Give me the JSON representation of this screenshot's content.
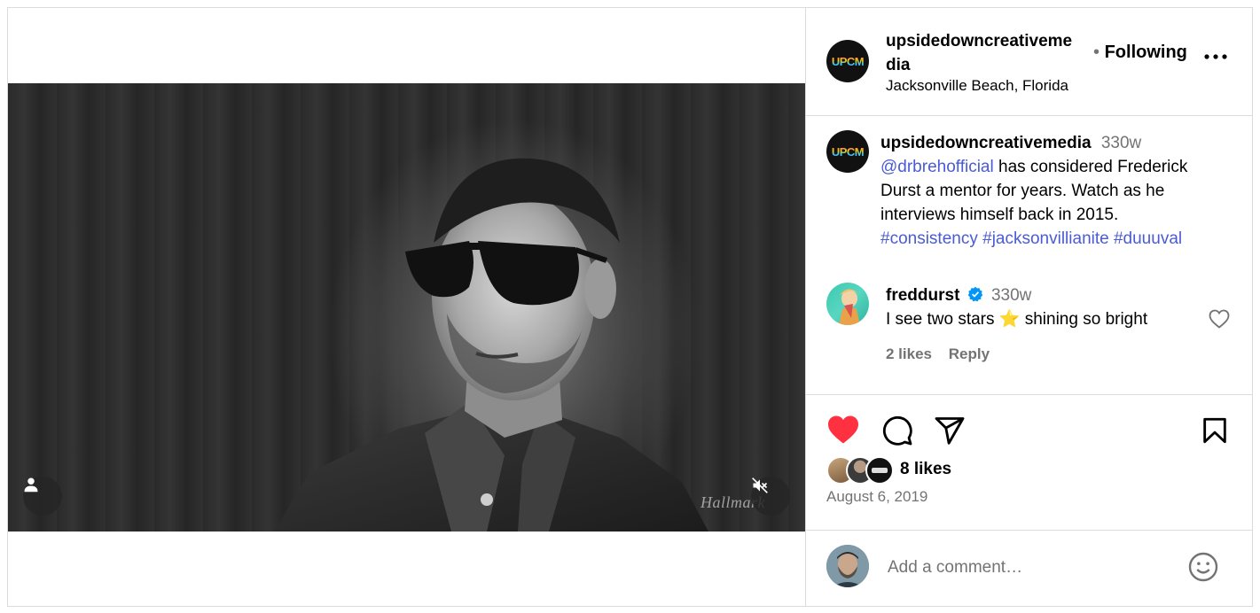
{
  "post": {
    "author": "upsidedowncreativemedia",
    "author_line1": "upsidedowncreativeme",
    "author_line2": "dia",
    "location": "Jacksonville Beach, Florida",
    "follow_sep": "•",
    "follow_label": "Following",
    "more_label": "...",
    "avatar_text": "UPCM",
    "watermark": "Hallmark",
    "caption": {
      "username": "upsidedowncreativemedia",
      "time": "330w",
      "mention": "@drbrehofficial",
      "text1": "has considered Frederick",
      "text2": "Durst a mentor for years. Watch as he",
      "text3": "interviews himself back in 2015.",
      "hashtags": [
        "#consistency",
        "#jacksonvillianite",
        "#duuuval"
      ]
    },
    "comments": [
      {
        "username": "freddurst",
        "verified": true,
        "time": "330w",
        "text_before": "I see two stars",
        "emoji": "⭐",
        "text_after": "shining so bright",
        "likes": "2 likes",
        "reply_label": "Reply"
      }
    ],
    "likes": "8 likes",
    "date": "August 6, 2019",
    "comment_placeholder": "Add a comment…"
  },
  "colors": {
    "heart": "#ff3040",
    "link": "#4a5bd4",
    "verified": "#0095f6",
    "muted": "#737373",
    "border": "#dbdbdb"
  },
  "icons": [
    "person-tag-icon",
    "muted-speaker-icon",
    "heart-icon",
    "comment-icon",
    "share-icon",
    "bookmark-icon",
    "emoji-icon",
    "verified-badge-icon",
    "comment-like-icon"
  ]
}
